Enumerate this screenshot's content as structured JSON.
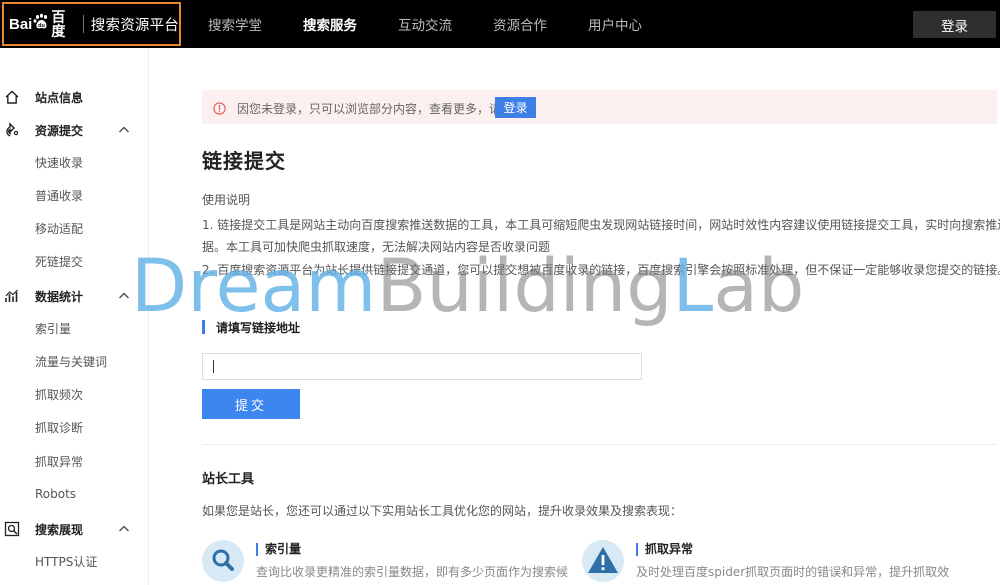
{
  "brand": {
    "logo_bai": "Bai",
    "logo_du": "百度",
    "name": "搜索资源平台"
  },
  "nav": {
    "items": [
      {
        "label": "搜索学堂"
      },
      {
        "label": "搜索服务"
      },
      {
        "label": "互动交流"
      },
      {
        "label": "资源合作"
      },
      {
        "label": "用户中心"
      }
    ],
    "active_index": 1,
    "login_label": "登录"
  },
  "sidebar": {
    "sections": [
      {
        "label": "站点信息",
        "icon": "home-icon"
      },
      {
        "label": "资源提交",
        "icon": "submit-icon",
        "items": [
          "快速收录",
          "普通收录",
          "移动适配",
          "死链提交"
        ]
      },
      {
        "label": "数据统计",
        "icon": "stats-icon",
        "items": [
          "索引量",
          "流量与关键词",
          "抓取频次",
          "抓取诊断",
          "抓取异常",
          "Robots"
        ]
      },
      {
        "label": "搜索展现",
        "icon": "search-display-icon",
        "items": [
          "HTTPS认证"
        ]
      }
    ]
  },
  "notice": {
    "text": "因您未登录，只可以浏览部分内容，查看更多，请",
    "login_label": "登录"
  },
  "main": {
    "title": "链接提交",
    "usage_title": "使用说明",
    "usage_lines": [
      "1. 链接提交工具是网站主动向百度搜索推送数据的工具，本工具可缩短爬虫发现网站链接时间，网站时效性内容建议使用链接提交工具，实时向搜索推送数",
      "据。本工具可加快爬虫抓取速度，无法解决网站内容是否收录问题",
      "2. 百度搜索资源平台为站长提供链接提交通道，您可以提交想被百度收录的链接，百度搜索引擎会按照标准处理，但不保证一定能够收录您提交的链接。"
    ],
    "field_label": "请填写链接地址",
    "url_value": "",
    "submit_label": "提交"
  },
  "tools": {
    "title": "站长工具",
    "desc": "如果您是站长，您还可以通过以下实用站长工具优化您的网站，提升收录效果及搜索表现：",
    "cards": [
      {
        "name": "索引量",
        "desc": "查询比收录更精准的索引量数据，即有多少页面作为搜索候",
        "icon": "magnifier-icon"
      },
      {
        "name": "抓取异常",
        "desc": "及时处理百度spider抓取页面时的错误和异常，提升抓取效",
        "icon": "warning-icon"
      }
    ]
  },
  "watermark": {
    "part1": "Dream",
    "part2": "B",
    "part3": "uilding",
    "part4": "L",
    "part5": "ab"
  },
  "colors": {
    "accent": "#3d7fe6",
    "brand_border": "#e8862c",
    "topbar": "#000000",
    "notice_bg": "#fcefef"
  }
}
